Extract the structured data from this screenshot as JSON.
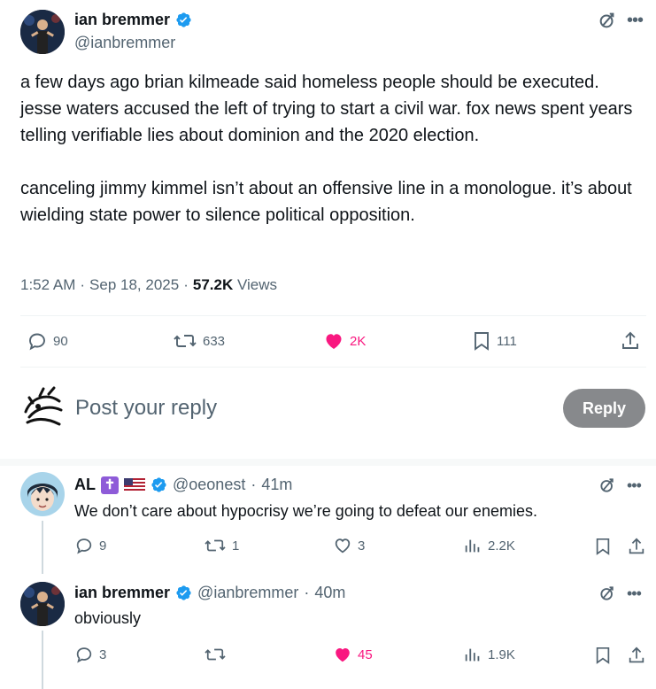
{
  "main_post": {
    "author_name": "ian bremmer",
    "handle": "@ianbremmer",
    "paragraph1": "a few days ago brian kilmeade said homeless people should be executed. jesse waters accused the left of trying to start a civil war. fox news spent years telling verifiable lies about dominion and the 2020 election.",
    "paragraph2": "canceling jimmy kimmel isn’t about an offensive line in a monologue. it’s about wielding state power to silence political opposition.",
    "time": "1:52 AM",
    "date": "Sep 18, 2025",
    "views_count": "57.2K",
    "views_label": "Views",
    "replies": "90",
    "reposts": "633",
    "likes": "2K",
    "bookmarks": "111"
  },
  "composer": {
    "placeholder": "Post your reply",
    "button_label": "Reply"
  },
  "replies": [
    {
      "author_name": "AL",
      "badge": "✝",
      "handle": "@oeonest",
      "time": "41m",
      "text": "We don’t care about hypocrisy we’re going to defeat our enemies.",
      "replies": "9",
      "reposts": "1",
      "likes": "3",
      "views": "2.2K"
    },
    {
      "author_name": "ian bremmer",
      "handle": "@ianbremmer",
      "time": "40m",
      "text": "obviously",
      "replies": "3",
      "reposts": "",
      "likes": "45",
      "views": "1.9K"
    }
  ],
  "colors": {
    "like_pink": "#f91880",
    "verified_blue": "#1d9bf0",
    "secondary_text": "#536471"
  },
  "separator": "·"
}
